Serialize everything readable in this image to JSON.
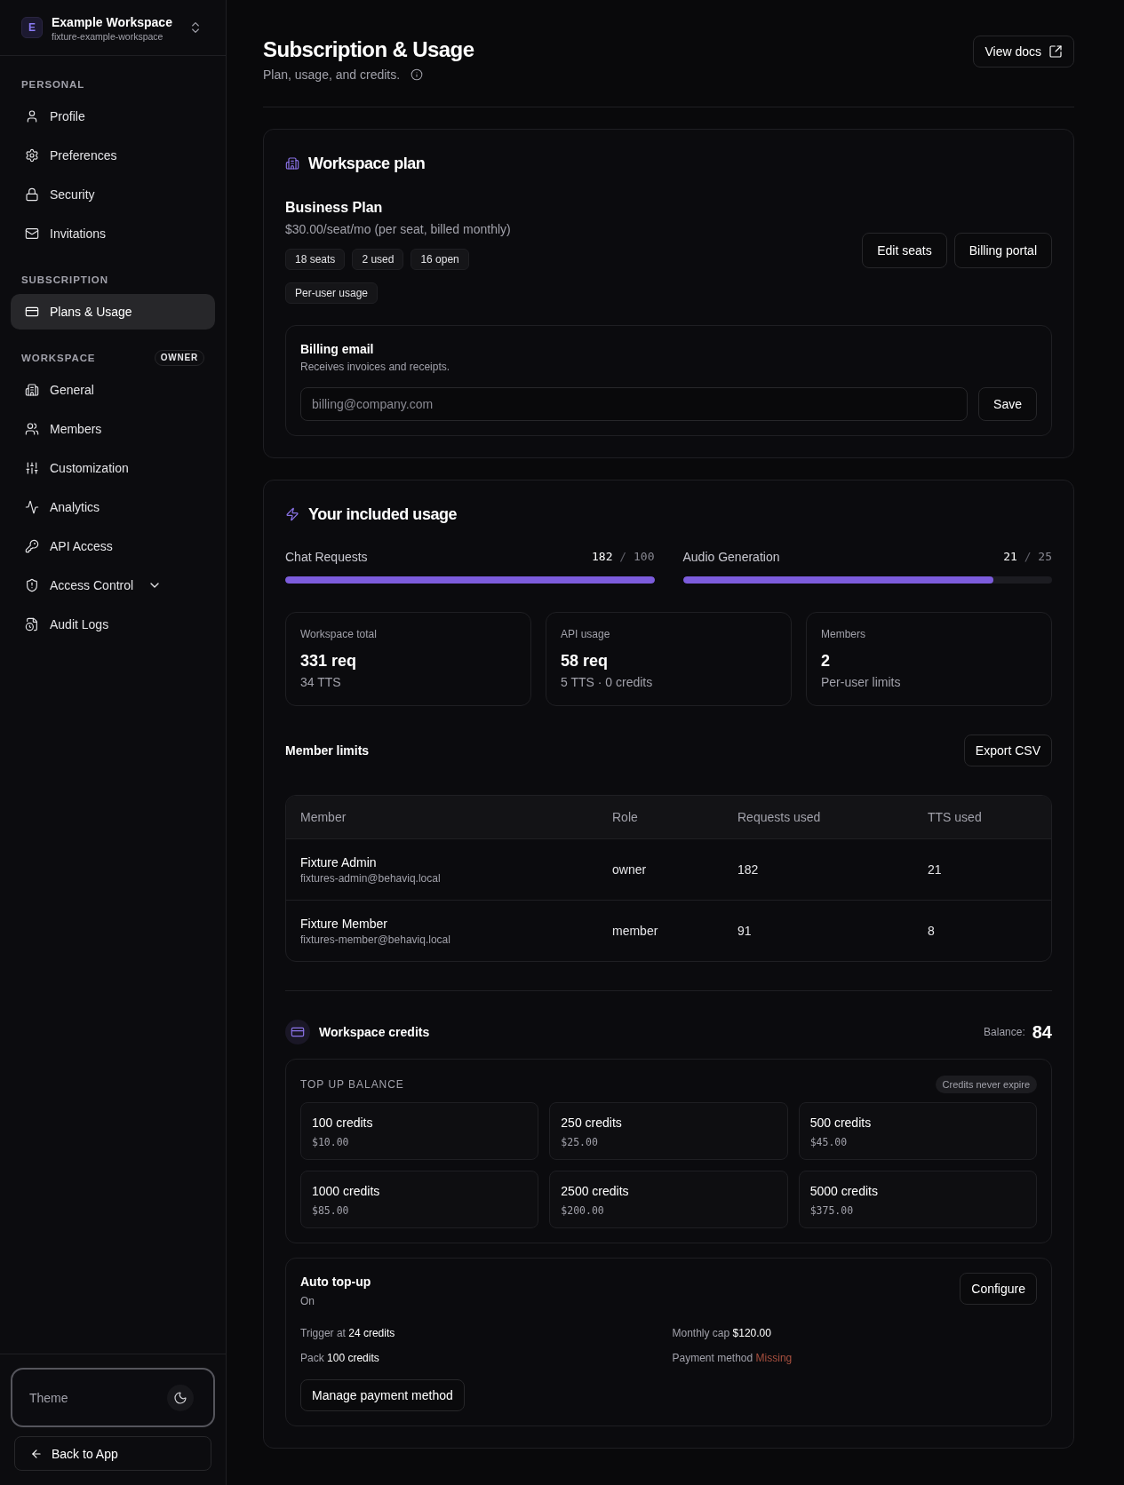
{
  "sidebar": {
    "workspace": {
      "initial": "E",
      "name": "Example Workspace",
      "slug": "fixture-example-workspace"
    },
    "sections": [
      {
        "label": "PERSONAL",
        "items": [
          {
            "label": "Profile",
            "kind": "link",
            "selected": false
          },
          {
            "label": "Preferences",
            "kind": "link",
            "selected": false
          },
          {
            "label": "Security",
            "kind": "link",
            "selected": false
          },
          {
            "label": "Invitations",
            "kind": "link",
            "selected": false
          }
        ]
      },
      {
        "label": "SUBSCRIPTION",
        "items": [
          {
            "label": "Plans & Usage",
            "kind": "link",
            "selected": true
          }
        ]
      },
      {
        "label": "WORKSPACE",
        "badge": "OWNER",
        "items": [
          {
            "label": "General",
            "kind": "link",
            "selected": false
          },
          {
            "label": "Members",
            "kind": "link",
            "selected": false
          },
          {
            "label": "Customization",
            "kind": "link",
            "selected": false
          },
          {
            "label": "Analytics",
            "kind": "link",
            "selected": false
          },
          {
            "label": "API Access",
            "kind": "link",
            "selected": false
          },
          {
            "label": "Access Control",
            "kind": "group",
            "selected": false,
            "expanded": false
          },
          {
            "label": "Audit Logs",
            "kind": "link",
            "selected": false
          }
        ]
      }
    ],
    "theme": {
      "label": "Theme"
    },
    "back_button": "Back to App"
  },
  "header": {
    "title": "Subscription & Usage",
    "subtitle": "Plan, usage, and credits.",
    "docs_button": "View docs"
  },
  "plan": {
    "heading": "Workspace plan",
    "name": "Business Plan",
    "price": "$30.00/seat/mo (per seat, billed monthly)",
    "seat_tags": [
      "18 seats",
      "2 used",
      "16 open"
    ],
    "usage_tag": "Per-user usage",
    "buttons": [
      "Edit seats",
      "Billing portal"
    ],
    "billing_email": {
      "title": "Billing email",
      "description": "Receives invoices and receipts.",
      "placeholder": "billing@company.com",
      "button": "Save"
    }
  },
  "usage": {
    "heading": "Your included usage",
    "meters": [
      {
        "label": "Chat Requests",
        "used": "182",
        "separator": "/",
        "limit": "100",
        "level": 1
      },
      {
        "label": "Audio Generation",
        "used": "21",
        "separator": "/",
        "limit": "25",
        "level": 0.84
      }
    ],
    "stats": [
      {
        "label": "Workspace total",
        "value": "331 req",
        "detail": "34 TTS"
      },
      {
        "label": "API usage",
        "value": "58 req",
        "detail": "5 TTS · 0 credits"
      },
      {
        "label": "Members",
        "value": "2",
        "detail": "Per-user limits"
      }
    ],
    "member_limits": {
      "title": "Member limits",
      "export_button": "Export CSV",
      "columns": [
        "Member",
        "Role",
        "Requests used",
        "TTS used"
      ],
      "rows": [
        {
          "name": "Fixture Admin",
          "email": "fixtures-admin@behaviq.local",
          "role": "owner",
          "requests": "182",
          "tts": "21"
        },
        {
          "name": "Fixture Member",
          "email": "fixtures-member@behaviq.local",
          "role": "member",
          "requests": "91",
          "tts": "8"
        }
      ]
    }
  },
  "credits": {
    "title": "Workspace credits",
    "balance_label": "Balance:",
    "balance": "84",
    "top_up": {
      "title": "TOP UP BALANCE",
      "note": "Credits never expire",
      "packs": [
        {
          "credits": "100 credits",
          "price": "$10.00"
        },
        {
          "credits": "250 credits",
          "price": "$25.00"
        },
        {
          "credits": "500 credits",
          "price": "$45.00"
        },
        {
          "credits": "1000 credits",
          "price": "$85.00"
        },
        {
          "credits": "2500 credits",
          "price": "$200.00"
        },
        {
          "credits": "5000 credits",
          "price": "$375.00"
        }
      ]
    },
    "auto_top_up": {
      "title": "Auto top-up",
      "status": "On",
      "configure_button": "Configure",
      "details": [
        {
          "label": "Trigger at",
          "value": "24 credits",
          "kind": "value"
        },
        {
          "label": "Monthly cap",
          "value": "$120.00",
          "kind": "value"
        },
        {
          "label": "Pack",
          "value": "100 credits",
          "kind": "value"
        },
        {
          "label": "Payment method",
          "value": "Missing",
          "kind": "alert"
        }
      ],
      "payment_button": "Manage payment method"
    }
  }
}
